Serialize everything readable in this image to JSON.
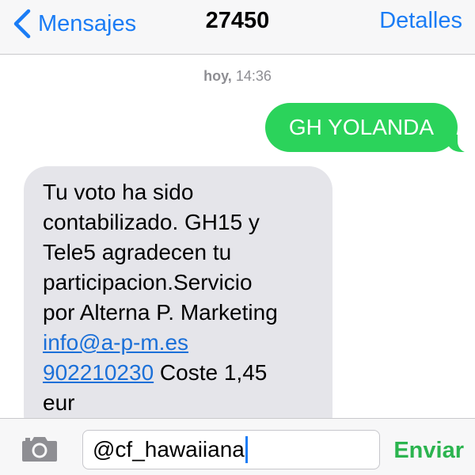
{
  "nav": {
    "back_label": "Mensajes",
    "title": "27450",
    "details_label": "Detalles"
  },
  "conversation": {
    "timestamp_day": "hoy,",
    "timestamp_time": "14:36",
    "sent_message": "GH YOLANDA",
    "received_message": {
      "text": "Tu voto ha sido\ncontabilizado. GH15 y\nTele5 agradecen tu\nparticipacion.Servicio\npor Alterna P. Marketing\n",
      "email_link": "info@a-p-m.es",
      "phone_link": "902210230",
      "tail_text": " Coste 1,45\neur"
    }
  },
  "composer": {
    "input_value": "@cf_hawaiiana",
    "send_label": "Enviar"
  },
  "colors": {
    "ios_blue": "#1a7cf5",
    "sent_bubble": "#2bd35b",
    "received_bubble": "#e5e5ea",
    "send_green": "#2bb44f"
  },
  "icons": {
    "back": "chevron-left-icon",
    "camera": "camera-icon"
  }
}
